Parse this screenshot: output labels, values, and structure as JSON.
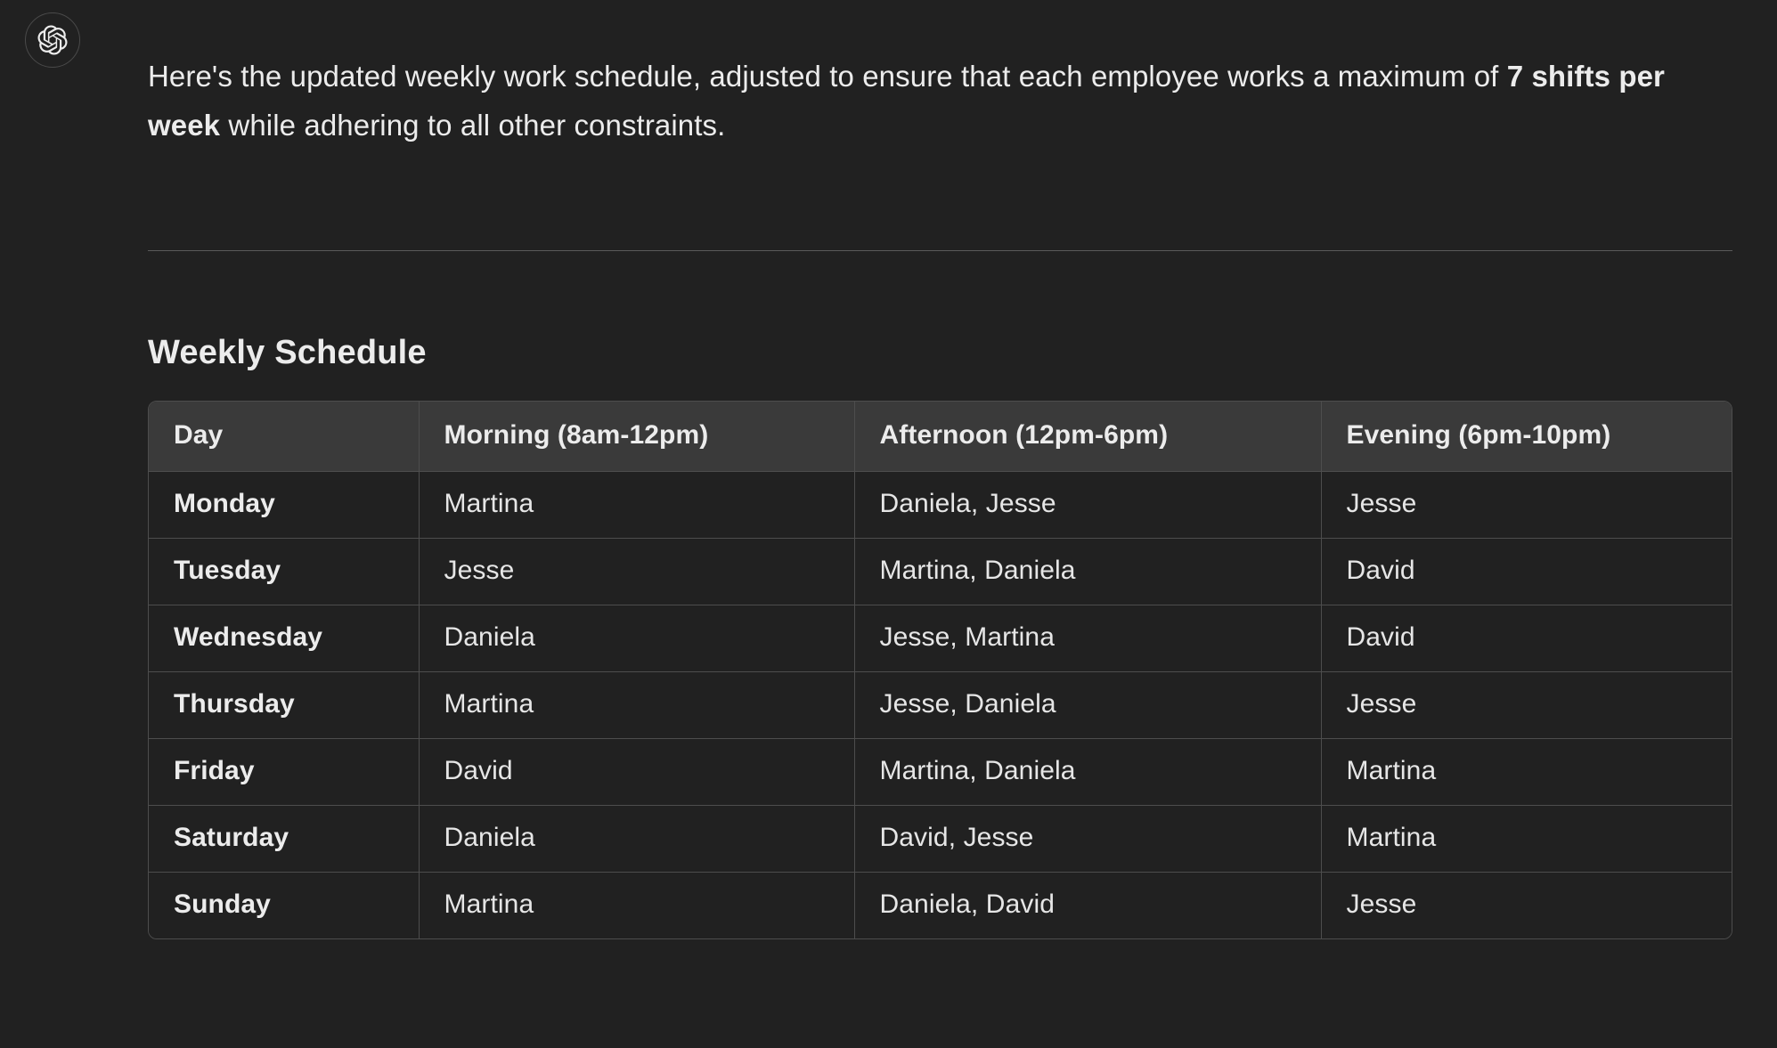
{
  "assistant": {
    "avatar_icon": "openai-logo-icon"
  },
  "message": {
    "intro_part1": "Here's the updated weekly work schedule, adjusted to ensure that each employee works a maximum of ",
    "intro_bold": "7 shifts per week",
    "intro_part2": " while adhering to all other constraints.",
    "section_title": "Weekly Schedule"
  },
  "colors": {
    "background": "#212121",
    "table_header_bg": "#3a3a3a",
    "border": "#4d4d4d",
    "text_primary": "#ececec",
    "divider": "#5a5a5a"
  },
  "table": {
    "columns": [
      "Day",
      "Morning (8am-12pm)",
      "Afternoon (12pm-6pm)",
      "Evening (6pm-10pm)"
    ],
    "rows": [
      {
        "day": "Monday",
        "morning": "Martina",
        "afternoon": "Daniela, Jesse",
        "evening": "Jesse"
      },
      {
        "day": "Tuesday",
        "morning": "Jesse",
        "afternoon": "Martina, Daniela",
        "evening": "David"
      },
      {
        "day": "Wednesday",
        "morning": "Daniela",
        "afternoon": "Jesse, Martina",
        "evening": "David"
      },
      {
        "day": "Thursday",
        "morning": "Martina",
        "afternoon": "Jesse, Daniela",
        "evening": "Jesse"
      },
      {
        "day": "Friday",
        "morning": "David",
        "afternoon": "Martina, Daniela",
        "evening": "Martina"
      },
      {
        "day": "Saturday",
        "morning": "Daniela",
        "afternoon": "David, Jesse",
        "evening": "Martina"
      },
      {
        "day": "Sunday",
        "morning": "Martina",
        "afternoon": "Daniela, David",
        "evening": "Jesse"
      }
    ]
  }
}
